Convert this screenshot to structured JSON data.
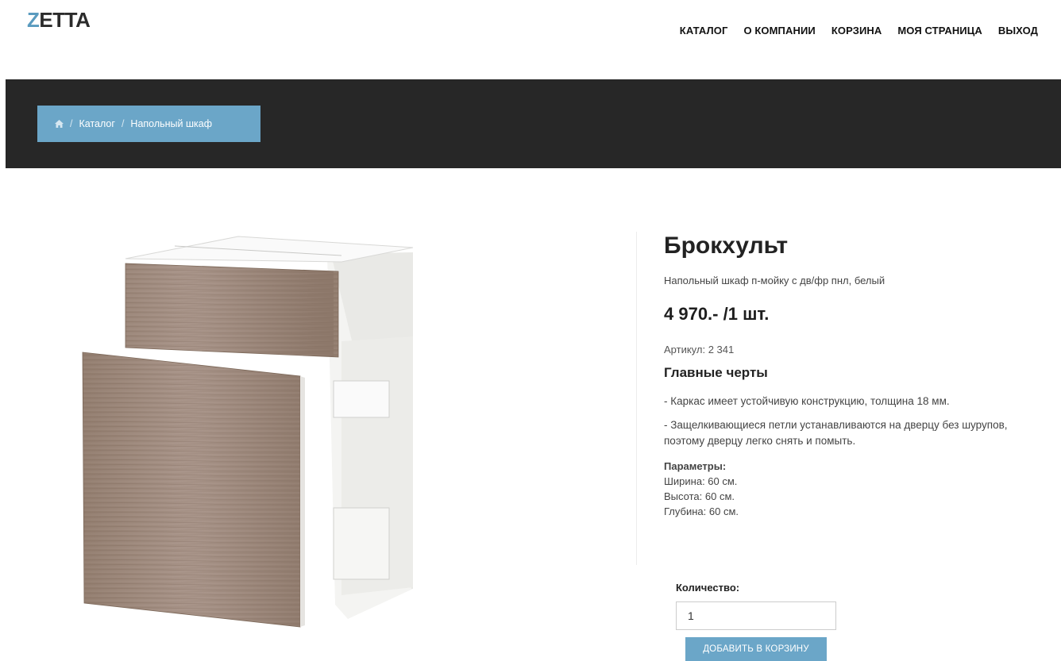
{
  "logo": {
    "first_letter": "Z",
    "rest": "ETTA"
  },
  "nav": [
    {
      "label": "КАТАЛОГ"
    },
    {
      "label": "О КОМПАНИИ"
    },
    {
      "label": "КОРЗИНА"
    },
    {
      "label": "МОЯ СТРАНИЦА"
    },
    {
      "label": "ВЫХОД"
    }
  ],
  "breadcrumb": {
    "separator": "/",
    "items": [
      "Каталог",
      "Напольный шкаф"
    ]
  },
  "product": {
    "title": "Брокхульт",
    "subtitle": "Напольный шкаф п-мойку с дв/фр пнл, белый",
    "price": "4 970.- /1 шт.",
    "sku": "Артикул: 2 341",
    "features_title": "Главные черты",
    "features": [
      "- Каркас имеет устойчивую конструкцию, толщина 18 мм.",
      "- Защелкивающиеся петли устанавливаются на дверцу без шурупов, поэтому дверцу легко снять и помыть."
    ],
    "params_title": "Параметры:",
    "params": [
      "Ширина: 60 см.",
      "Высота: 60 см.",
      "Глубина: 60 см."
    ]
  },
  "quantity": {
    "label": "Количество:",
    "value": "1"
  },
  "add_to_cart_label": "ДОБАВИТЬ В КОРЗИНУ",
  "colors": {
    "accent": "#6ba6c8",
    "banner": "#272727",
    "wood": "#a18c7c"
  }
}
